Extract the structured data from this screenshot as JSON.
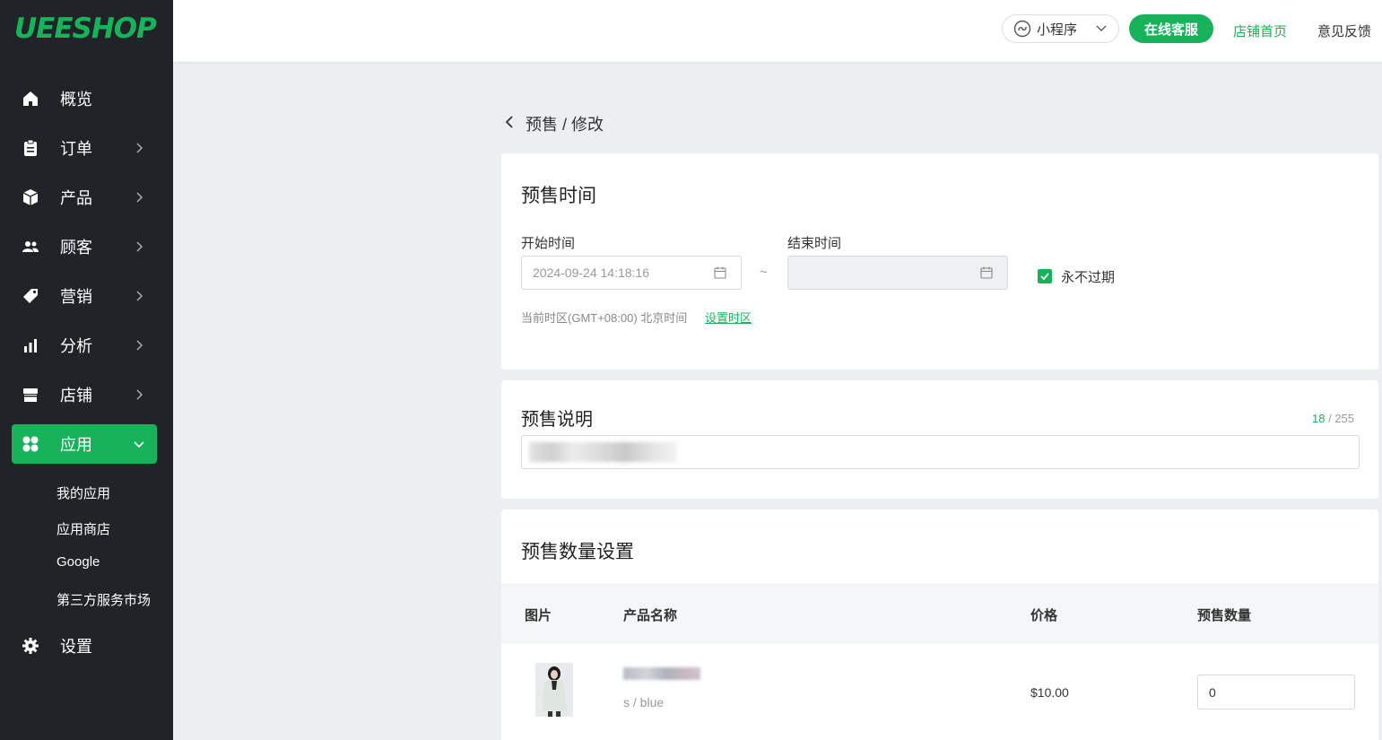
{
  "sidebar": {
    "logo": "UEESHOP",
    "items": [
      {
        "label": "概览",
        "icon": "home-icon"
      },
      {
        "label": "订单",
        "icon": "clipboard-icon"
      },
      {
        "label": "产品",
        "icon": "box-icon"
      },
      {
        "label": "顾客",
        "icon": "users-icon"
      },
      {
        "label": "营销",
        "icon": "tag-icon"
      },
      {
        "label": "分析",
        "icon": "bar-chart-icon"
      },
      {
        "label": "店铺",
        "icon": "store-icon"
      },
      {
        "label": "应用",
        "icon": "apps-grid-icon"
      },
      {
        "label": "设置",
        "icon": "gear-icon"
      }
    ],
    "sub_items": [
      "我的应用",
      "应用商店",
      "Google",
      "第三方服务市场"
    ]
  },
  "topbar": {
    "miniapp_label": "小程序",
    "support_button": "在线客服",
    "store_home": "店铺首页",
    "feedback": "意见反馈"
  },
  "breadcrumb": "预售 / 修改",
  "time_card": {
    "title": "预售时间",
    "start_label": "开始时间",
    "start_value": "2024-09-24 14:18:16",
    "separator": "~",
    "end_label": "结束时间",
    "end_value": "",
    "never_expire_label": "永不过期",
    "never_expire_checked": true,
    "timezone_text": "当前时区(GMT+08:00) 北京时间",
    "timezone_link": "设置时区"
  },
  "desc_card": {
    "title": "预售说明",
    "count": "18",
    "max": "/ 255"
  },
  "qty_card": {
    "title": "预售数量设置",
    "columns": [
      "图片",
      "产品名称",
      "价格",
      "预售数量"
    ],
    "rows": [
      {
        "variant": "s / blue",
        "price": "$10.00",
        "quantity": "0"
      }
    ]
  },
  "colors": {
    "accent": "#17b35a",
    "sidebar_bg": "#202328",
    "page_bg": "#eceff2"
  }
}
